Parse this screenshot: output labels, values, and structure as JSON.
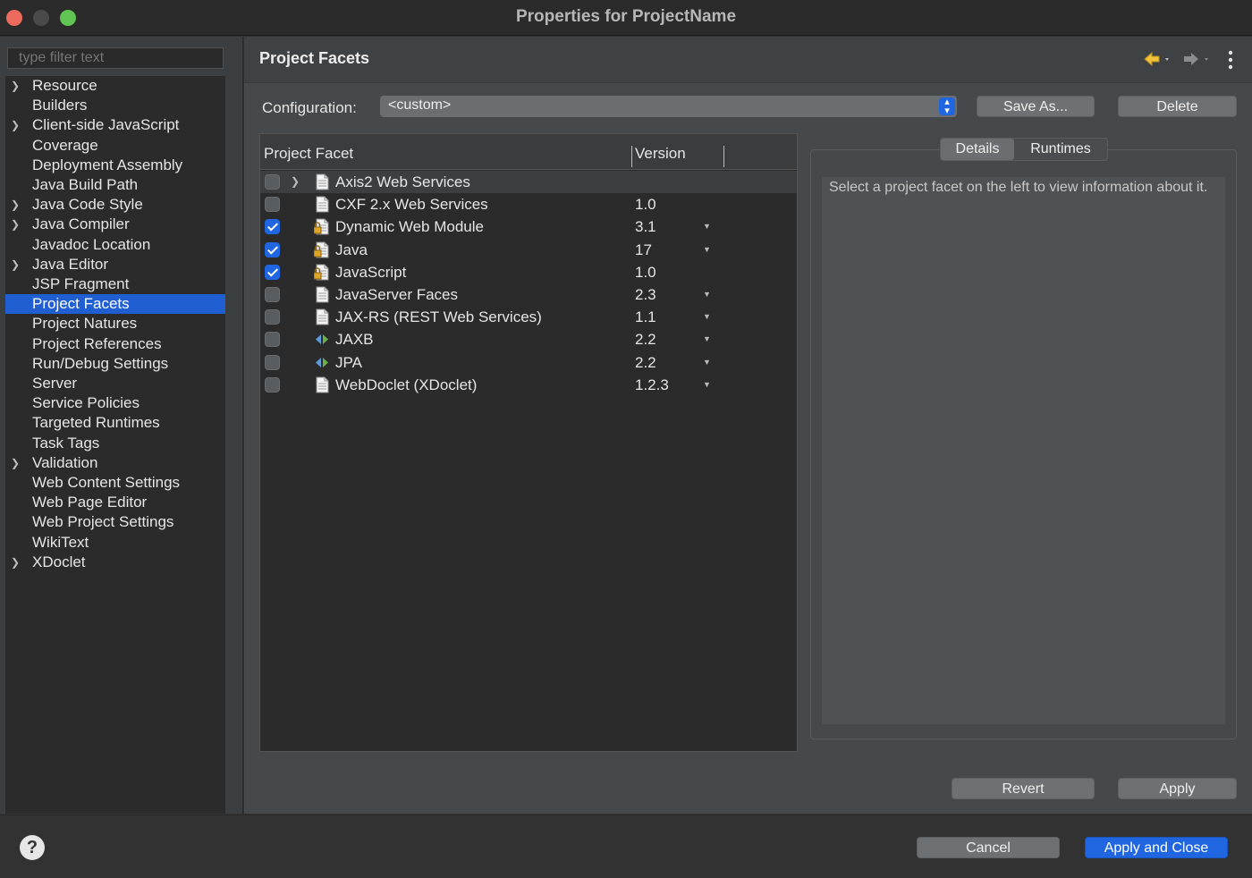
{
  "window": {
    "title": "Properties for ProjectName"
  },
  "filter": {
    "placeholder": "type filter text"
  },
  "tree": {
    "items": [
      {
        "label": "Resource",
        "expandable": true
      },
      {
        "label": "Builders",
        "expandable": false
      },
      {
        "label": "Client-side JavaScript",
        "expandable": true
      },
      {
        "label": "Coverage",
        "expandable": false
      },
      {
        "label": "Deployment Assembly",
        "expandable": false
      },
      {
        "label": "Java Build Path",
        "expandable": false
      },
      {
        "label": "Java Code Style",
        "expandable": true
      },
      {
        "label": "Java Compiler",
        "expandable": true
      },
      {
        "label": "Javadoc Location",
        "expandable": false
      },
      {
        "label": "Java Editor",
        "expandable": true
      },
      {
        "label": "JSP Fragment",
        "expandable": false
      },
      {
        "label": "Project Facets",
        "expandable": false,
        "selected": true
      },
      {
        "label": "Project Natures",
        "expandable": false
      },
      {
        "label": "Project References",
        "expandable": false
      },
      {
        "label": "Run/Debug Settings",
        "expandable": false
      },
      {
        "label": "Server",
        "expandable": false
      },
      {
        "label": "Service Policies",
        "expandable": false
      },
      {
        "label": "Targeted Runtimes",
        "expandable": false
      },
      {
        "label": "Task Tags",
        "expandable": false
      },
      {
        "label": "Validation",
        "expandable": true
      },
      {
        "label": "Web Content Settings",
        "expandable": false
      },
      {
        "label": "Web Page Editor",
        "expandable": false
      },
      {
        "label": "Web Project Settings",
        "expandable": false
      },
      {
        "label": "WikiText",
        "expandable": false
      },
      {
        "label": "XDoclet",
        "expandable": true
      }
    ]
  },
  "page": {
    "title": "Project Facets",
    "configuration_label": "Configuration:",
    "configuration_value": "<custom>",
    "save_as": "Save As...",
    "delete": "Delete"
  },
  "facets": {
    "header_facet": "Project Facet",
    "header_version": "Version",
    "rows": [
      {
        "name": "Axis2 Web Services",
        "version": "",
        "checked": false,
        "expandable": true,
        "icon": "document-icon",
        "dropdown": false
      },
      {
        "name": "CXF 2.x Web Services",
        "version": "1.0",
        "checked": false,
        "expandable": false,
        "icon": "document-icon",
        "dropdown": false
      },
      {
        "name": "Dynamic Web Module",
        "version": "3.1",
        "checked": true,
        "expandable": false,
        "icon": "locked-document-icon",
        "dropdown": true
      },
      {
        "name": "Java",
        "version": "17",
        "checked": true,
        "expandable": false,
        "icon": "locked-document-icon",
        "dropdown": true
      },
      {
        "name": "JavaScript",
        "version": "1.0",
        "checked": true,
        "expandable": false,
        "icon": "locked-document-icon",
        "dropdown": false
      },
      {
        "name": "JavaServer Faces",
        "version": "2.3",
        "checked": false,
        "expandable": false,
        "icon": "document-icon",
        "dropdown": true
      },
      {
        "name": "JAX-RS (REST Web Services)",
        "version": "1.1",
        "checked": false,
        "expandable": false,
        "icon": "document-icon",
        "dropdown": true
      },
      {
        "name": "JAXB",
        "version": "2.2",
        "checked": false,
        "expandable": false,
        "icon": "arrows-icon",
        "dropdown": true
      },
      {
        "name": "JPA",
        "version": "2.2",
        "checked": false,
        "expandable": false,
        "icon": "arrows-icon",
        "dropdown": true
      },
      {
        "name": "WebDoclet (XDoclet)",
        "version": "1.2.3",
        "checked": false,
        "expandable": false,
        "icon": "document-icon",
        "dropdown": true
      }
    ]
  },
  "details": {
    "tab_details": "Details",
    "tab_runtimes": "Runtimes",
    "text": "Select a project facet on the left to view information about it."
  },
  "buttons": {
    "revert": "Revert",
    "apply": "Apply",
    "cancel": "Cancel",
    "apply_close": "Apply and Close",
    "help": "?"
  },
  "colors": {
    "accent": "#1f66e0",
    "selection": "#1f5fd1",
    "close": "#ed6a5e",
    "maximize": "#61c554"
  }
}
